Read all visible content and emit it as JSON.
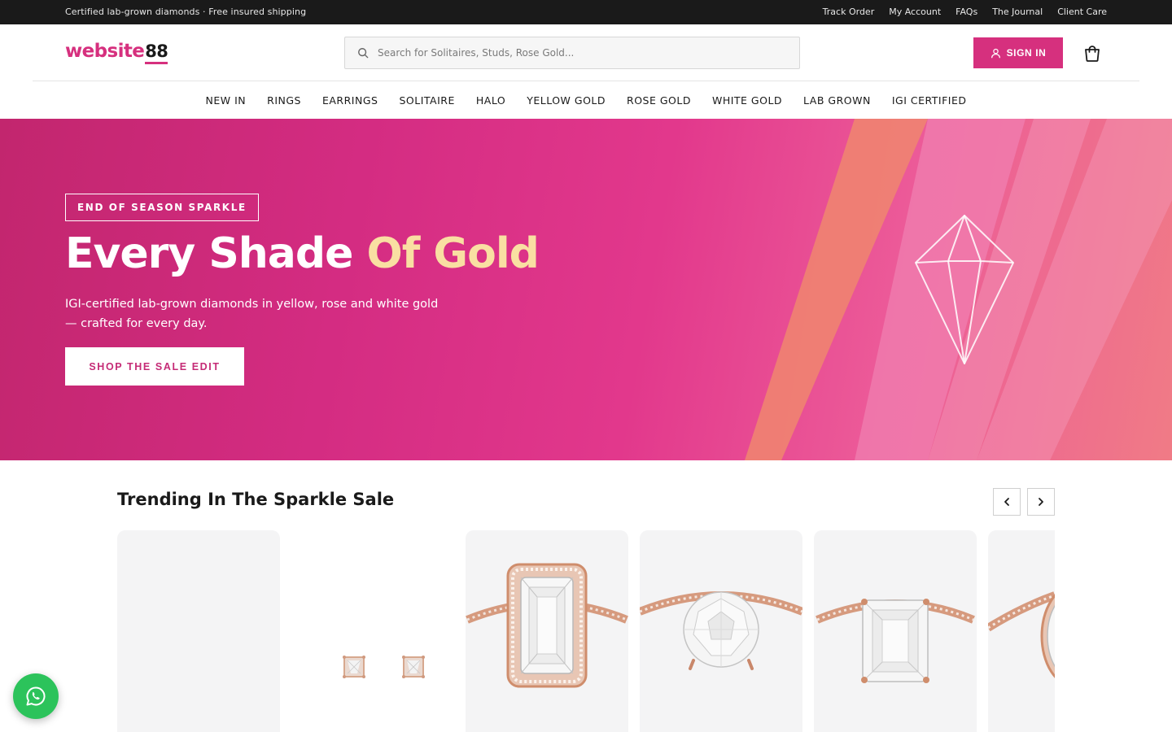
{
  "topbar": {
    "message": "Certified lab-grown diamonds · Free insured shipping",
    "links": [
      "Track Order",
      "My Account",
      "FAQs",
      "The Journal",
      "Client Care"
    ]
  },
  "header": {
    "logo_text": "website",
    "logo_number": "88",
    "search_placeholder": "Search for Solitaires, Studs, Rose Gold...",
    "signin_label": "SIGN IN"
  },
  "nav": {
    "items": [
      "NEW IN",
      "RINGS",
      "EARRINGS",
      "SOLITAIRE",
      "HALO",
      "YELLOW GOLD",
      "ROSE GOLD",
      "WHITE GOLD",
      "LAB GROWN",
      "IGI CERTIFIED"
    ]
  },
  "hero": {
    "tag": "END OF SEASON SPARKLE",
    "title_main": "Every Shade ",
    "title_accent": "Of Gold",
    "subtitle": "IGI-certified lab-grown diamonds in yellow, rose and white gold — crafted for every day.",
    "cta_label": "SHOP THE SALE EDIT"
  },
  "trending": {
    "title": "Trending In The Sparkle Sale",
    "products": [
      {
        "image": "placeholder"
      },
      {
        "image": "princess-cut-stud-earrings"
      },
      {
        "image": "emerald-cut-halo-ring-rose-gold"
      },
      {
        "image": "round-solitaire-pave-ring-rose-gold"
      },
      {
        "image": "emerald-cut-pave-ring-rose-gold"
      },
      {
        "image": "halo-ring-rose-gold-partial"
      }
    ]
  },
  "colors": {
    "brand_pink": "#d6307e",
    "accent_gold": "#f9dfa2",
    "topbar": "#1a1a1a",
    "whatsapp_green": "#2cc35b"
  }
}
